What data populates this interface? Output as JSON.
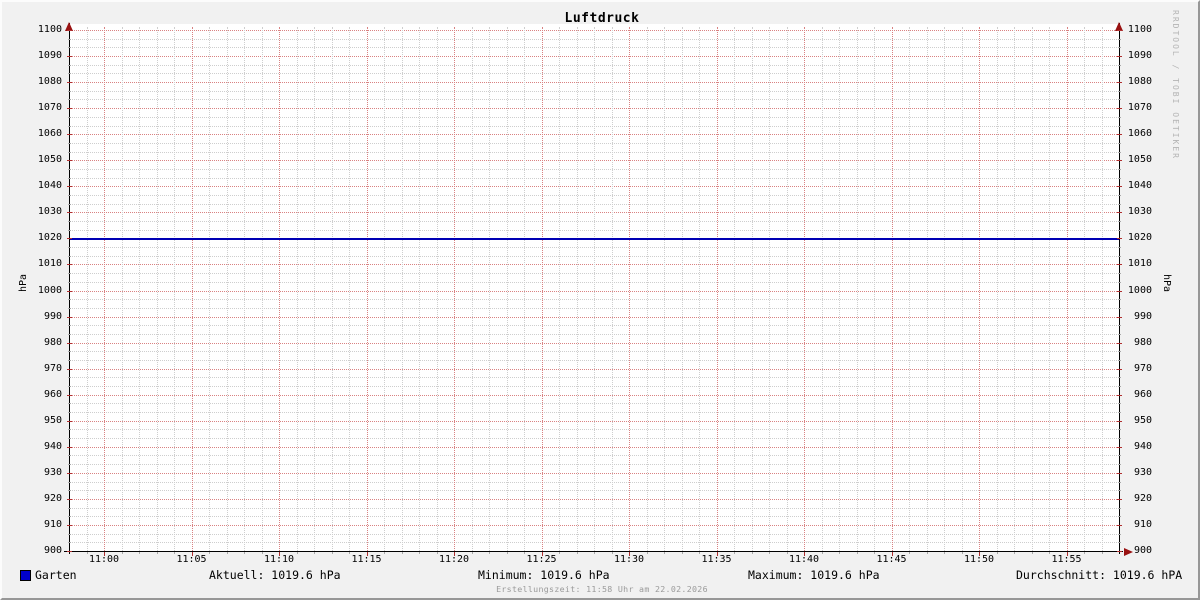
{
  "chart_data": {
    "type": "line",
    "title": "Luftdruck",
    "ylabel": "hPa",
    "ylim": [
      900,
      1100
    ],
    "y_major_step": 10,
    "y_minor_divisions_per_major": 3,
    "y_tick_labels": [
      "1100",
      "1090",
      "1080",
      "1070",
      "1060",
      "1050",
      "1040",
      "1030",
      "1020",
      "1010",
      "1000",
      "990",
      "980",
      "970",
      "960",
      "950",
      "940",
      "930",
      "920",
      "910",
      "900"
    ],
    "x_tick_labels": [
      "11:00",
      "11:05",
      "11:10",
      "11:15",
      "11:20",
      "11:25",
      "11:30",
      "11:35",
      "11:40",
      "11:45",
      "11:50",
      "11:55"
    ],
    "x_range": [
      "10:58",
      "11:58"
    ],
    "x_minutes_total": 60,
    "x_label_first_minute_offset": 2,
    "x_label_step_minutes": 5,
    "grid": true,
    "legend_position": "bottom",
    "series": [
      {
        "name": "Garten",
        "color": "#0000cc",
        "line_color": "#0000b4",
        "constant_value": 1019.6
      }
    ]
  },
  "colors": {
    "background": "#f1f1f1",
    "canvas": "#ffffff",
    "major_grid": "#d98282",
    "minor_grid": "#cecece",
    "axis": "#000000",
    "arrow": "#991111",
    "watermark": "#b4b4b4",
    "footer_text": "#9a9a9a"
  },
  "legend": {
    "series_label": "Garten",
    "stats": [
      {
        "id": "aktuell",
        "label": "Aktuell: 1019.6 hPa"
      },
      {
        "id": "minimum",
        "label": "Minimum: 1019.6 hPa"
      },
      {
        "id": "maximum",
        "label": "Maximum: 1019.6 hPa"
      },
      {
        "id": "durchschnitt",
        "label": "Durchschnitt: 1019.6 hPA"
      }
    ]
  },
  "footer": "Erstellungszeit: 11:58 Uhr am 22.02.2026",
  "watermark": "RRDTOOL / TOBI OETIKER"
}
